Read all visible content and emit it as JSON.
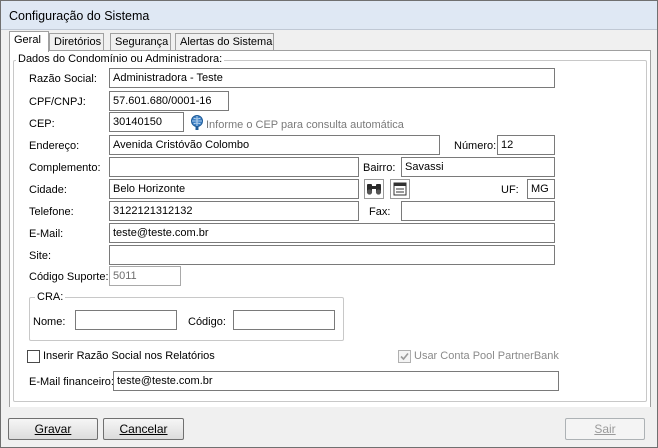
{
  "window": {
    "title": "Configuração do Sistema"
  },
  "tabs": [
    {
      "label": "Geral"
    },
    {
      "label": "Diretórios"
    },
    {
      "label": "Segurança"
    },
    {
      "label": "Alertas do Sistema"
    }
  ],
  "group_main": {
    "label": "Dados do Condomínio ou Administradora:"
  },
  "fields": {
    "razao_social": {
      "label": "Razão Social:",
      "value": "Administradora - Teste"
    },
    "cpf_cnpj": {
      "label": "CPF/CNPJ:",
      "value": "57.601.680/0001-16"
    },
    "cep": {
      "label": "CEP:",
      "value": "30140150",
      "hint": "Informe o CEP para consulta automática"
    },
    "endereco": {
      "label": "Endereço:",
      "value": "Avenida Cristóvão Colombo"
    },
    "numero": {
      "label": "Número:",
      "value": "12"
    },
    "complemento": {
      "label": "Complemento:",
      "value": ""
    },
    "bairro": {
      "label": "Bairro:",
      "value": "Savassi"
    },
    "cidade": {
      "label": "Cidade:",
      "value": "Belo Horizonte"
    },
    "uf": {
      "label": "UF:",
      "value": "MG"
    },
    "telefone": {
      "label": "Telefone:",
      "value": "3122121312132"
    },
    "fax": {
      "label": "Fax:",
      "value": ""
    },
    "email": {
      "label": "E-Mail:",
      "value": "teste@teste.com.br"
    },
    "site": {
      "label": "Site:",
      "value": ""
    },
    "codigo_suporte": {
      "label": "Código Suporte:",
      "value": "5011"
    }
  },
  "cra": {
    "label": "CRA:",
    "nome": {
      "label": "Nome:",
      "value": ""
    },
    "codigo": {
      "label": "Código:",
      "value": ""
    }
  },
  "checkboxes": {
    "inserir_razao": {
      "label": "Inserir Razão Social nos Relatórios",
      "checked": false
    },
    "conta_pool": {
      "label": "Usar Conta Pool PartnerBank",
      "checked": true,
      "disabled": true
    }
  },
  "email_financeiro": {
    "label": "E-Mail financeiro:",
    "value": "teste@teste.com.br"
  },
  "buttons": {
    "gravar": {
      "label": "Gravar"
    },
    "cancelar": {
      "label": "Cancelar"
    },
    "sair": {
      "label": "Sair"
    }
  },
  "colors": {
    "titlebar": "#dfe8f4",
    "cep_icon": "#3b7fc4"
  },
  "icons": {
    "cep": "globe-info-icon",
    "search": "binoculars-icon",
    "list": "list-icon"
  }
}
